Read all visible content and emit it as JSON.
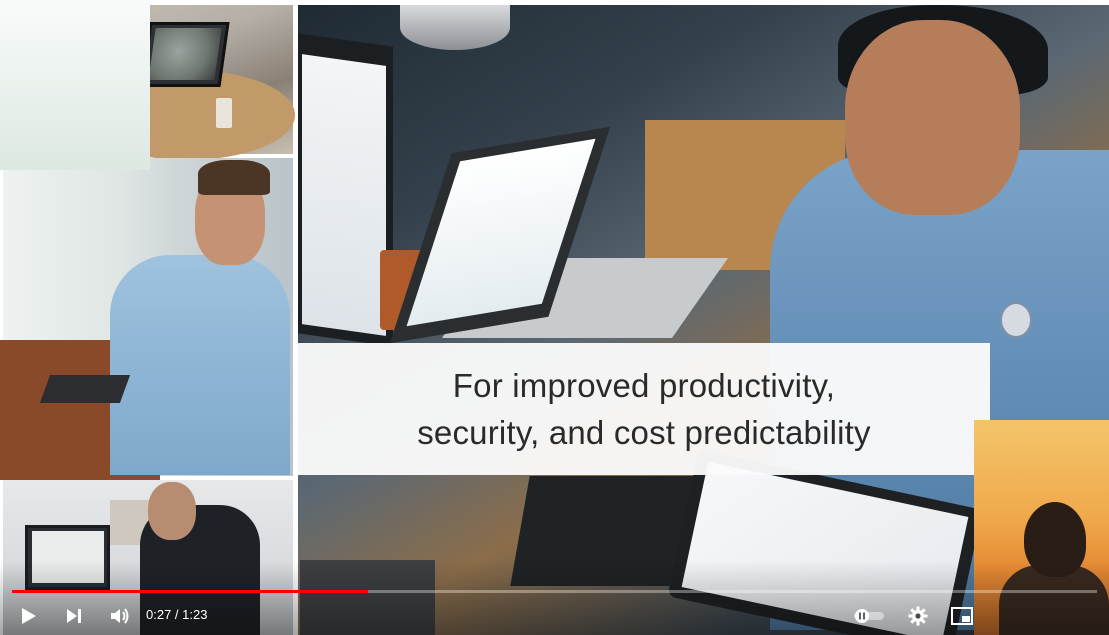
{
  "video": {
    "caption_line1": "For improved productivity,",
    "caption_line2": "security, and cost predictability",
    "progress_fraction": 0.328
  },
  "controls": {
    "current_time": "0:27",
    "separator": " / ",
    "duration": "1:23",
    "play_icon": "play-icon",
    "next_icon": "next-icon",
    "volume_icon": "volume-icon",
    "autoplay_icon": "autoplay-toggle-icon",
    "settings_icon": "gear-icon",
    "miniplayer_icon": "miniplayer-icon"
  },
  "colors": {
    "progress": "#ff0000",
    "controls_fg": "#ffffff"
  }
}
